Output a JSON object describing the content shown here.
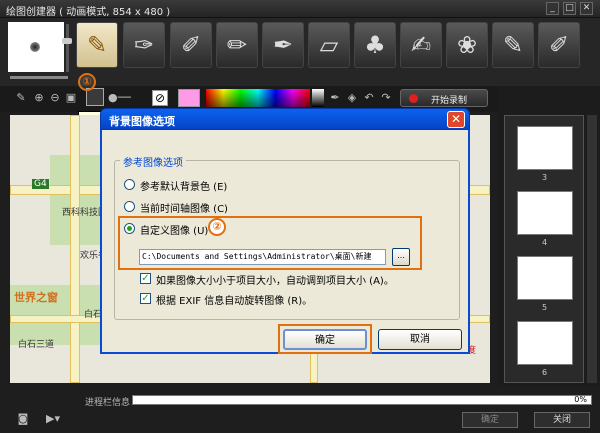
{
  "window": {
    "title": "绘图创建器 ( 动画模式, 854 x 480 )",
    "minimize": "_",
    "maximize": "□",
    "close": "✕"
  },
  "toolbar": {
    "tools": [
      "paintbrush",
      "spray",
      "chalk",
      "crayon",
      "marker",
      "eraser",
      "stamp",
      "pen",
      "flower-stamp",
      "fill-brush",
      "oil-brush"
    ]
  },
  "options_bar": {
    "bg_image_tooltip": "背景图像选项",
    "callout_1": "①",
    "record_label": "开始录制",
    "off_swatch": "⊘",
    "active_color": "#ff9be6"
  },
  "map": {
    "labels": [
      "G4",
      "西科科技园",
      "欢乐谷",
      "世界之窗",
      "白石洲",
      "白石三道",
      "百度"
    ]
  },
  "frames": {
    "numbers": [
      "3",
      "4",
      "5",
      "6"
    ]
  },
  "status": {
    "label": "进程栏信息",
    "percent": "0%"
  },
  "bottom_buttons": {
    "ok": "确定",
    "close": "关闭"
  },
  "dialog": {
    "title": "背景图像选项",
    "close": "✕",
    "group_label": "参考图像选项",
    "options": [
      {
        "label": "参考默认背景色 (E)",
        "checked": false
      },
      {
        "label": "当前时间轴图像 (C)",
        "checked": false
      },
      {
        "label": "自定义图像 (U)",
        "checked": true
      }
    ],
    "callout_2": "②",
    "path_value": "C:\\Documents and Settings\\Administrator\\桌面\\新建",
    "browse_label": "...",
    "checkboxes": [
      {
        "label": "如果图像大小小于项目大小，自动调到项目大小 (A)。",
        "checked": true
      },
      {
        "label": "根据 EXIF 信息自动旋转图像 (R)。",
        "checked": true
      }
    ],
    "ok": "确定",
    "cancel": "取消"
  }
}
